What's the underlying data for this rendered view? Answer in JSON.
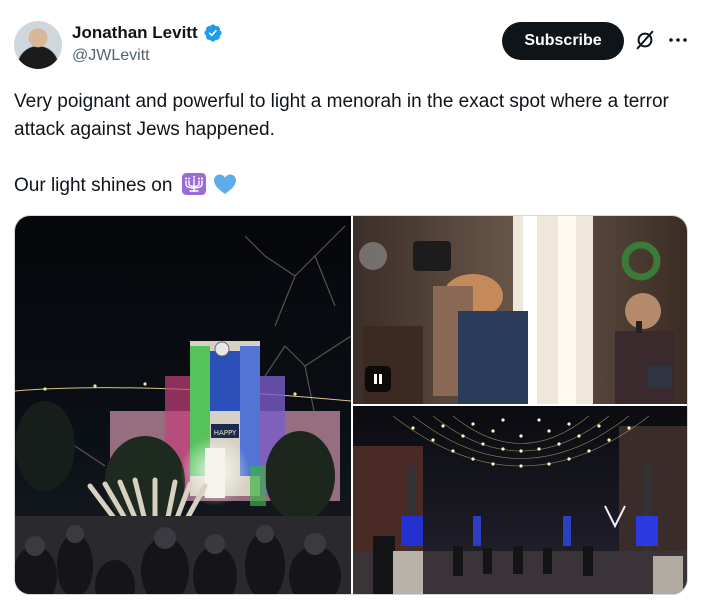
{
  "author": {
    "display_name": "Jonathan Levitt",
    "handle": "@JWLevitt",
    "verified": true
  },
  "actions": {
    "subscribe_label": "Subscribe",
    "grok_icon": "grok-icon",
    "more_icon": "more-icon"
  },
  "tweet": {
    "line1": "Very poignant and powerful to light a menorah in the exact spot where a terror attack against Jews happened.",
    "line2": "Our light shines on",
    "emojis": [
      "menorah-emoji",
      "blue-heart-emoji"
    ]
  },
  "media": {
    "count": 3,
    "video_control": "pause-icon"
  },
  "colors": {
    "text": "#0f1419",
    "secondary": "#536471",
    "verified_blue": "#1d9bf0",
    "button_bg": "#0f1419"
  }
}
